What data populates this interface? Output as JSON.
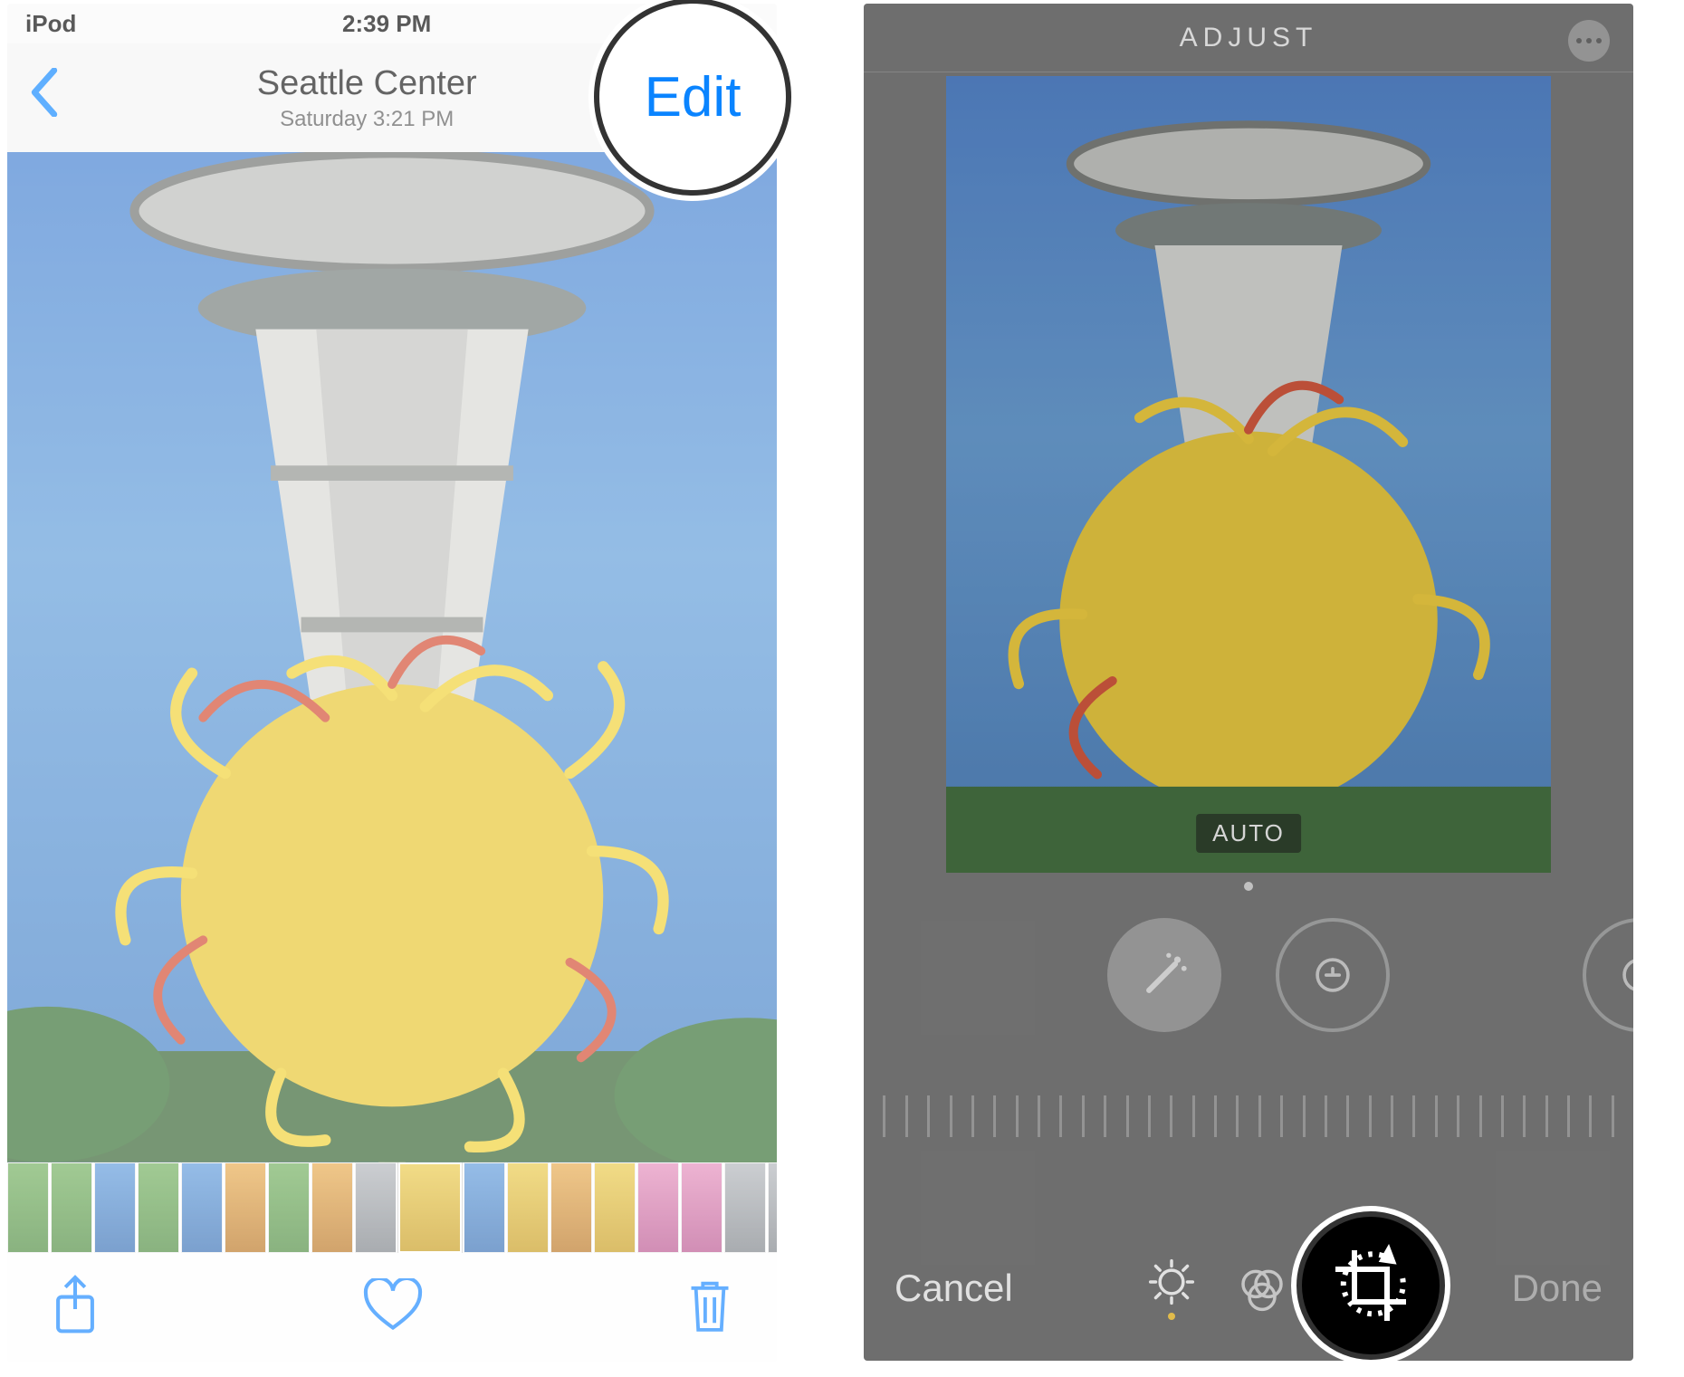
{
  "status_bar": {
    "device": "iPod",
    "time": "2:39 PM"
  },
  "nav": {
    "title": "Seattle Center",
    "subtitle": "Saturday  3:21 PM",
    "edit_label": "Edit"
  },
  "callout_edit_label": "Edit",
  "adjust": {
    "title": "ADJUST",
    "auto_label": "AUTO",
    "cancel_label": "Cancel",
    "done_label": "Done"
  },
  "tools": {
    "wand": "auto-enhance-wand",
    "exposure": "exposure-tool",
    "brilliance": "brilliance-tool"
  },
  "modes": {
    "adjust": "adjust-mode",
    "filters": "filters-mode",
    "crop": "crop-mode"
  },
  "thumbnails": {
    "count": 18,
    "selected_index": 9
  }
}
